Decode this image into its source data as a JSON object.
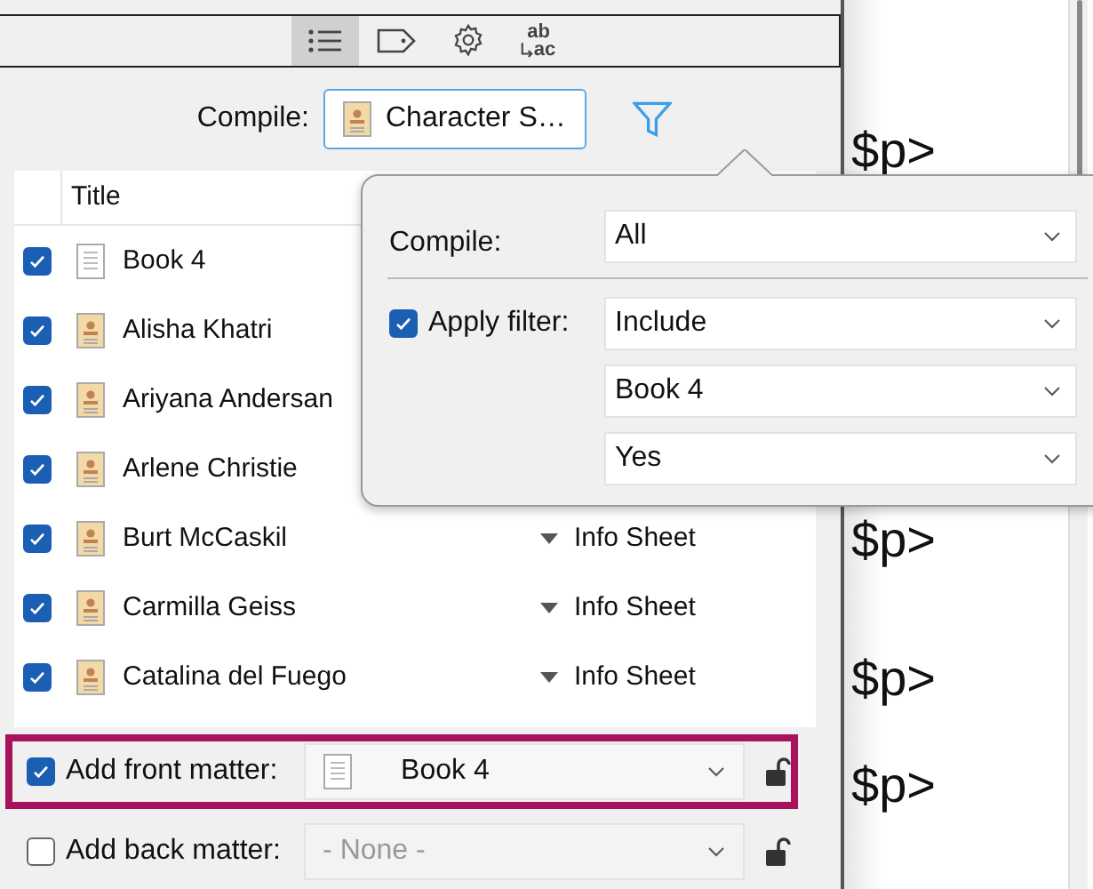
{
  "toolbar": {
    "buttons": [
      {
        "kind": "list",
        "selected": true
      },
      {
        "kind": "tag",
        "selected": false
      },
      {
        "kind": "gear",
        "selected": false
      },
      {
        "kind": "replace",
        "label_top": "ab",
        "label_bottom": "ac",
        "selected": false
      }
    ]
  },
  "compile": {
    "label": "Compile:",
    "value": "Character S…"
  },
  "table": {
    "columns": [
      "Title"
    ],
    "rows": [
      {
        "title": "Book 4",
        "kind": "document",
        "checked": true
      },
      {
        "title": "Alisha Khatri",
        "kind": "character",
        "checked": true
      },
      {
        "title": "Ariyana Andersan",
        "kind": "character",
        "checked": true
      },
      {
        "title": "Arlene Christie",
        "kind": "character",
        "checked": true
      },
      {
        "title": "Burt McCaskil",
        "kind": "character",
        "checked": true,
        "column_3": "Info Sheet"
      },
      {
        "title": "Carmilla Geiss",
        "kind": "character",
        "checked": true,
        "column_3": "Info Sheet"
      },
      {
        "title": "Catalina del Fuego",
        "kind": "character",
        "checked": true,
        "column_3": "Info Sheet"
      }
    ]
  },
  "popover": {
    "compile": {
      "label": "Compile:",
      "value": "All"
    },
    "apply_filter": {
      "label": "Apply filter:",
      "checked": true,
      "values": [
        "Include",
        "Book 4",
        "Yes"
      ]
    }
  },
  "front_matter": {
    "label": "Add front matter:",
    "checked": true,
    "value": "Book 4",
    "disabled": false,
    "highlighted": true
  },
  "back_matter": {
    "label": "Add back matter:",
    "checked": false,
    "value": "- None -",
    "disabled": true,
    "highlighted": false
  },
  "editor": {
    "lines": [
      "$p>",
      "$p>",
      "$p>",
      "$p>"
    ]
  }
}
